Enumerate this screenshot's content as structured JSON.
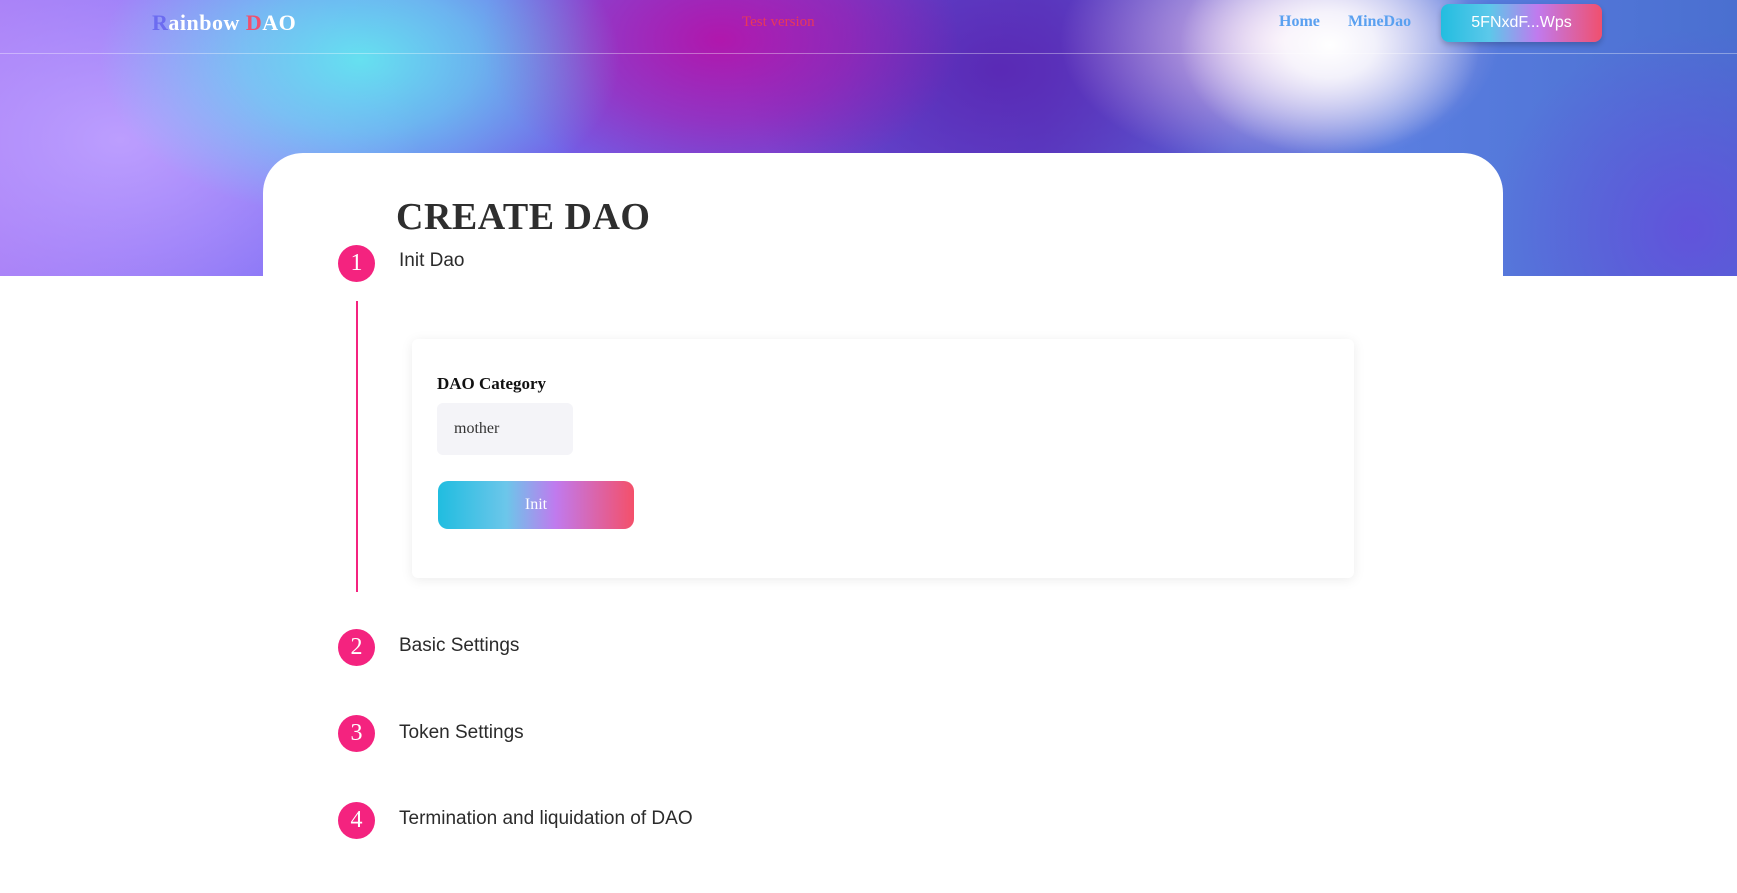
{
  "header": {
    "logo": {
      "r": "R",
      "ainbow": "ainbow ",
      "d": "D",
      "ao": "AO"
    },
    "test_version": "Test version",
    "nav": {
      "home": "Home",
      "mine_dao": "MineDao"
    },
    "wallet_label": "5FNxdF...Wps"
  },
  "main": {
    "title": "CREATE DAO",
    "steps": [
      {
        "number": "1",
        "label": "Init Dao"
      },
      {
        "number": "2",
        "label": "Basic Settings"
      },
      {
        "number": "3",
        "label": "Token Settings"
      },
      {
        "number": "4",
        "label": "Termination and liquidation of DAO"
      }
    ],
    "init_panel": {
      "category_label": "DAO Category",
      "category_value": "mother",
      "init_button": "Init"
    }
  },
  "colors": {
    "step_accent": "#f4237f",
    "nav_link": "#5aa0f0",
    "test_version": "#e8385a"
  }
}
